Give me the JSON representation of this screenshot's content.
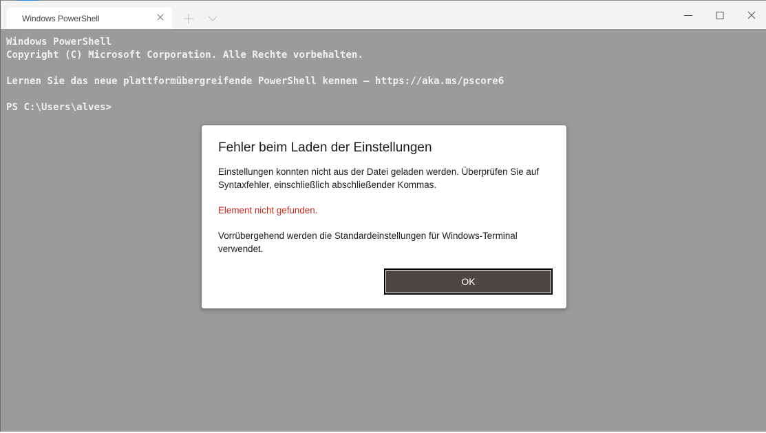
{
  "window": {
    "tab_title": "Windows PowerShell",
    "icons": {
      "tab_close": "close-icon",
      "new_tab": "plus-icon",
      "dropdown": "chevron-down-icon",
      "minimize": "minimize-icon",
      "maximize": "maximize-icon",
      "close": "close-icon"
    },
    "colors": {
      "terminal_background": "#9b9b9b",
      "terminal_text": "#f0f0f0",
      "titlebar": "#f3f3f3",
      "error_text": "#c42b1c",
      "ok_button": "#4a4744"
    }
  },
  "terminal": {
    "lines": [
      "Windows PowerShell",
      "Copyright (C) Microsoft Corporation. Alle Rechte vorbehalten.",
      "",
      "Lernen Sie das neue plattformübergreifende PowerShell kennen – https://aka.ms/pscore6",
      "",
      "PS C:\\Users\\alves>"
    ]
  },
  "dialog": {
    "title": "Fehler beim Laden der Einstellungen",
    "message": "Einstellungen konnten nicht aus der Datei geladen werden. Überprüfen Sie auf Syntaxfehler, einschließlich abschließender Kommas.",
    "error": "Element nicht gefunden.",
    "message2": "Vorrübergehend werden die Standardeinstellungen für Windows-Terminal verwendet.",
    "ok_label": "OK"
  }
}
